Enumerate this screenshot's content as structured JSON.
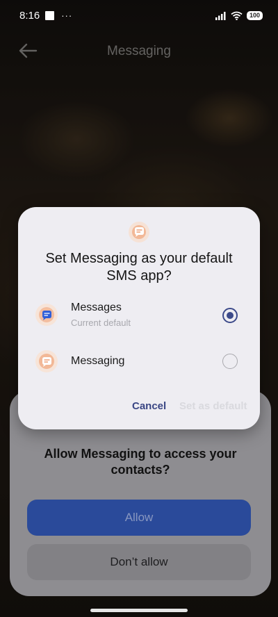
{
  "status_bar": {
    "time": "8:16",
    "more": "···",
    "battery": "100"
  },
  "app_header": {
    "title": "Messaging"
  },
  "permission_sheet": {
    "question": "Allow Messaging to access your contacts?",
    "allow_label": "Allow",
    "deny_label": "Don’t allow"
  },
  "dialog": {
    "title": "Set Messaging as your default SMS app?",
    "options": [
      {
        "name": "Messages",
        "subtitle": "Current default",
        "selected": true,
        "icon": "messages-app-icon"
      },
      {
        "name": "Messaging",
        "subtitle": "",
        "selected": false,
        "icon": "messaging-app-icon"
      }
    ],
    "cancel_label": "Cancel",
    "set_default_label": "Set as default"
  },
  "colors": {
    "accent": "#3c4a8a",
    "dialog_bg": "#eeedf2",
    "allow_bg": "#2a4a9a"
  }
}
